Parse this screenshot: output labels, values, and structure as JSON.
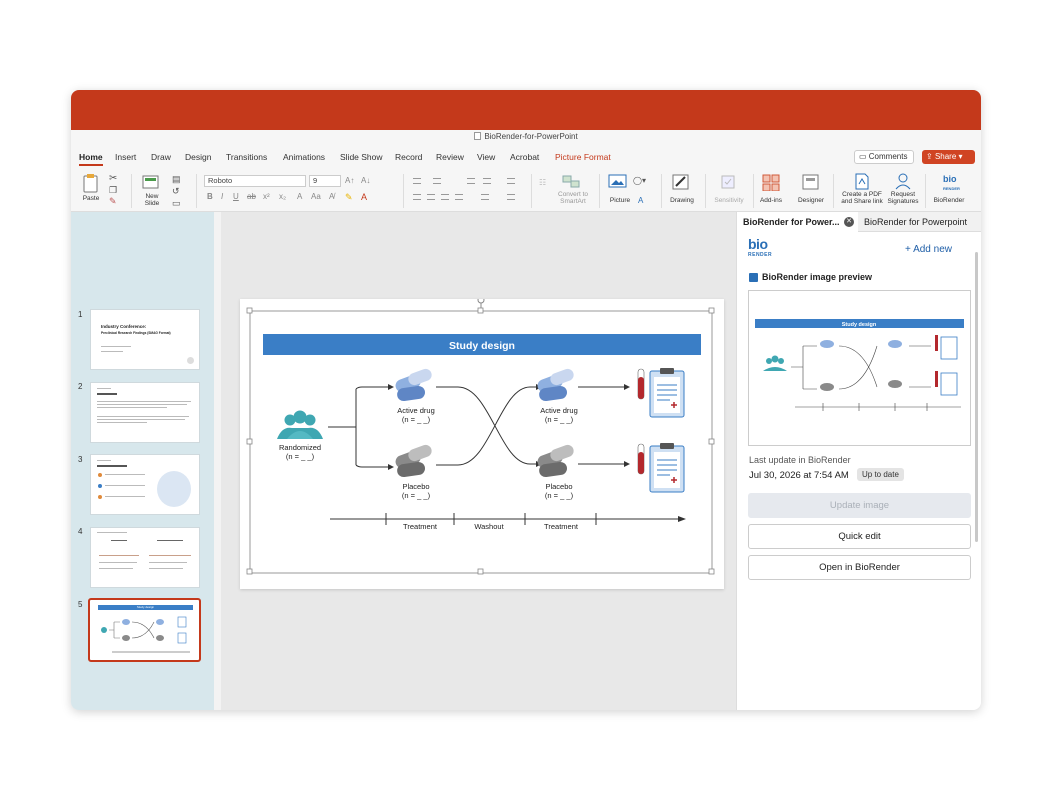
{
  "window": {
    "title": "BioRender-for-PowerPoint"
  },
  "ribbon_tabs": [
    "Home",
    "Insert",
    "Draw",
    "Design",
    "Transitions",
    "Animations",
    "Slide Show",
    "Record",
    "Review",
    "View",
    "Acrobat",
    "Picture Format"
  ],
  "header_buttons": {
    "comments": "Comments",
    "share": "Share"
  },
  "ribbon": {
    "paste": "Paste",
    "new_slide": "New Slide",
    "font": "Roboto",
    "font_size": "9",
    "convert": "Convert to SmartArt",
    "picture": "Picture",
    "drawing": "Drawing",
    "sensitivity": "Sensitivity",
    "addins": "Add-ins",
    "designer": "Designer",
    "create_pdf": "Create a PDF and Share link",
    "request_sig": "Request Signatures",
    "biorender": "BioRender"
  },
  "thumbnails": {
    "numbers": [
      "1",
      "2",
      "3",
      "4",
      "5"
    ],
    "slide1_title": "Industry Conference:",
    "slide1_subtitle": "Preclinical Research Findings (SMAG Format)",
    "slide5_title": "Study design"
  },
  "slide": {
    "title": "Study design",
    "randomized": "Randomized",
    "n_label": "(n = _ _)",
    "active_drug": "Active drug",
    "placebo": "Placebo",
    "treatment": "Treatment",
    "washout": "Washout"
  },
  "pane": {
    "tab_active": "BioRender for Power...",
    "tab_other": "BioRender for Powerpoint",
    "logo_top": "bio",
    "logo_bottom": "RENDER",
    "add_new": "+ Add new",
    "preview_heading": "BioRender image preview",
    "last_update_label": "Last update in BioRender",
    "last_update_date": "Jul 30, 2026 at 7:54 AM",
    "status_badge": "Up to date",
    "update_image": "Update image",
    "quick_edit": "Quick edit",
    "open_in": "Open in BioRender"
  },
  "colors": {
    "accent": "#c4391b",
    "slide_header": "#3a7ec6",
    "people": "#3fa7b2",
    "drug_blue": "#8fb0e0",
    "placebo_gray": "#8a8a8a",
    "tube_red": "#b3282d"
  }
}
